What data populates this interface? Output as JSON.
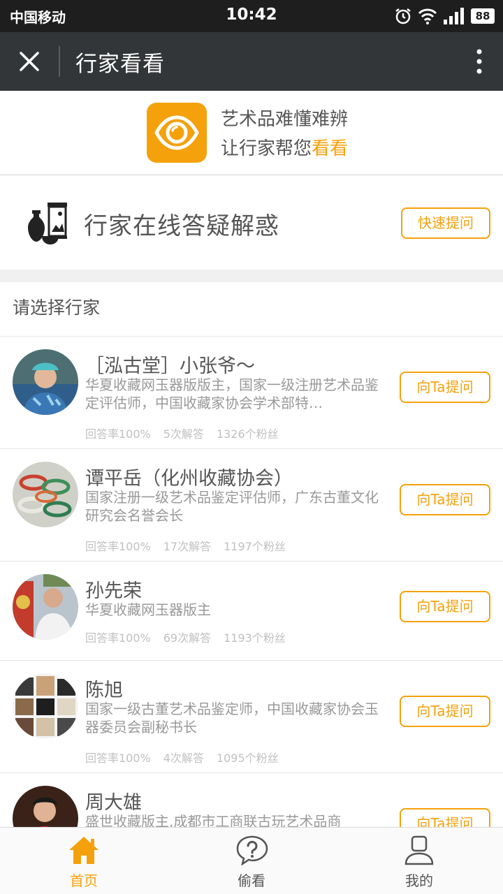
{
  "status_bar": {
    "carrier": "中国移动",
    "time": "10:42",
    "battery": "88"
  },
  "nav": {
    "title": "行家看看",
    "close_icon": "close-icon",
    "more_icon": "more-vertical-icon"
  },
  "banner": {
    "line1": "艺术品难懂难辨",
    "line2_prefix": "让行家帮您",
    "line2_highlight": "看看",
    "logo_icon": "eye-icon"
  },
  "online": {
    "text": "行家在线答疑解惑",
    "button": "快速提问",
    "icon": "antiques-icon"
  },
  "list": {
    "header": "请选择行家",
    "experts": [
      {
        "name": "［泓古堂］小张爷～",
        "bio": "华夏收藏网玉器版版主，国家一级注册艺术品鉴定评估师，中国收藏家协会学术部特…",
        "answer_rate": "回答率100%",
        "answers": "5次解答",
        "fans": "1326个粉丝",
        "button": "向Ta提问"
      },
      {
        "name": "谭平岳（化州收藏协会）",
        "bio": "国家注册一级艺术品鉴定评估师，广东古董文化研究会名誉会长",
        "answer_rate": "回答率100%",
        "answers": "17次解答",
        "fans": "1197个粉丝",
        "button": "向Ta提问"
      },
      {
        "name": "孙先荣",
        "bio": "华夏收藏网玉器版主",
        "answer_rate": "回答率100%",
        "answers": "69次解答",
        "fans": "1193个粉丝",
        "button": "向Ta提问"
      },
      {
        "name": "陈旭",
        "bio": "国家一级古董艺术品鉴定师，中国收藏家协会玉器委员会副秘书长",
        "answer_rate": "回答率100%",
        "answers": "4次解答",
        "fans": "1095个粉丝",
        "button": "向Ta提问"
      },
      {
        "name": "周大雄",
        "bio": "盛世收藏版主,成都市工商联古玩艺术品商",
        "button": "向Ta提问"
      }
    ]
  },
  "tabbar": {
    "tabs": [
      {
        "label": "首页",
        "icon": "home-icon",
        "active": true
      },
      {
        "label": "偷看",
        "icon": "question-bubble-icon",
        "active": false
      },
      {
        "label": "我的",
        "icon": "user-icon",
        "active": false
      }
    ]
  },
  "colors": {
    "accent": "#f5a10c",
    "navbar": "#333638",
    "statusbar": "#1e1e1e"
  }
}
